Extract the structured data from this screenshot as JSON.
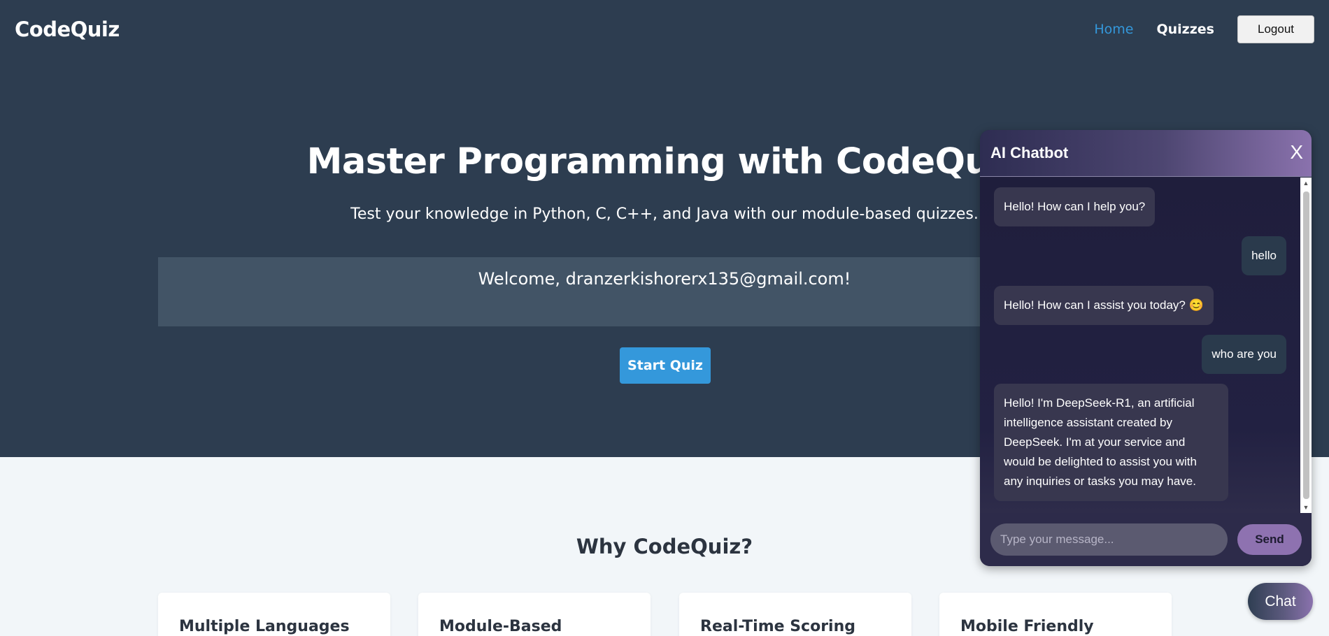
{
  "navbar": {
    "logo": "CodeQuiz",
    "links": [
      "Home",
      "Quizzes"
    ],
    "logout_label": "Logout"
  },
  "hero": {
    "title": "Master Programming with CodeQuiz",
    "subtitle": "Test your knowledge in Python, C, C++, and Java with our module-based quizzes.",
    "welcome": "Welcome, dranzerkishorerx135@gmail.com!",
    "start_label": "Start Quiz"
  },
  "features": {
    "title": "Why CodeQuiz?",
    "cards": [
      "Multiple Languages",
      "Module-Based",
      "Real-Time Scoring",
      "Mobile Friendly"
    ]
  },
  "chatbot": {
    "title": "AI Chatbot",
    "close_label": "X",
    "messages": [
      {
        "sender": "bot",
        "text": "Hello! How can I help you?"
      },
      {
        "sender": "user",
        "text": "hello"
      },
      {
        "sender": "bot",
        "text": "Hello! How can I assist you today? 😊"
      },
      {
        "sender": "user",
        "text": "who are you"
      },
      {
        "sender": "bot",
        "text": "Hello! I'm DeepSeek-R1, an artificial intelligence assistant created by DeepSeek. I'm at your service and would be delighted to assist you with any inquiries or tasks you may have."
      }
    ],
    "input_placeholder": "Type your message...",
    "send_label": "Send"
  },
  "chat_toggle_label": "Chat",
  "colors": {
    "navbar_bg": "#2d3d50",
    "accent": "#3498db",
    "chat_accent": "#8e72b0"
  }
}
